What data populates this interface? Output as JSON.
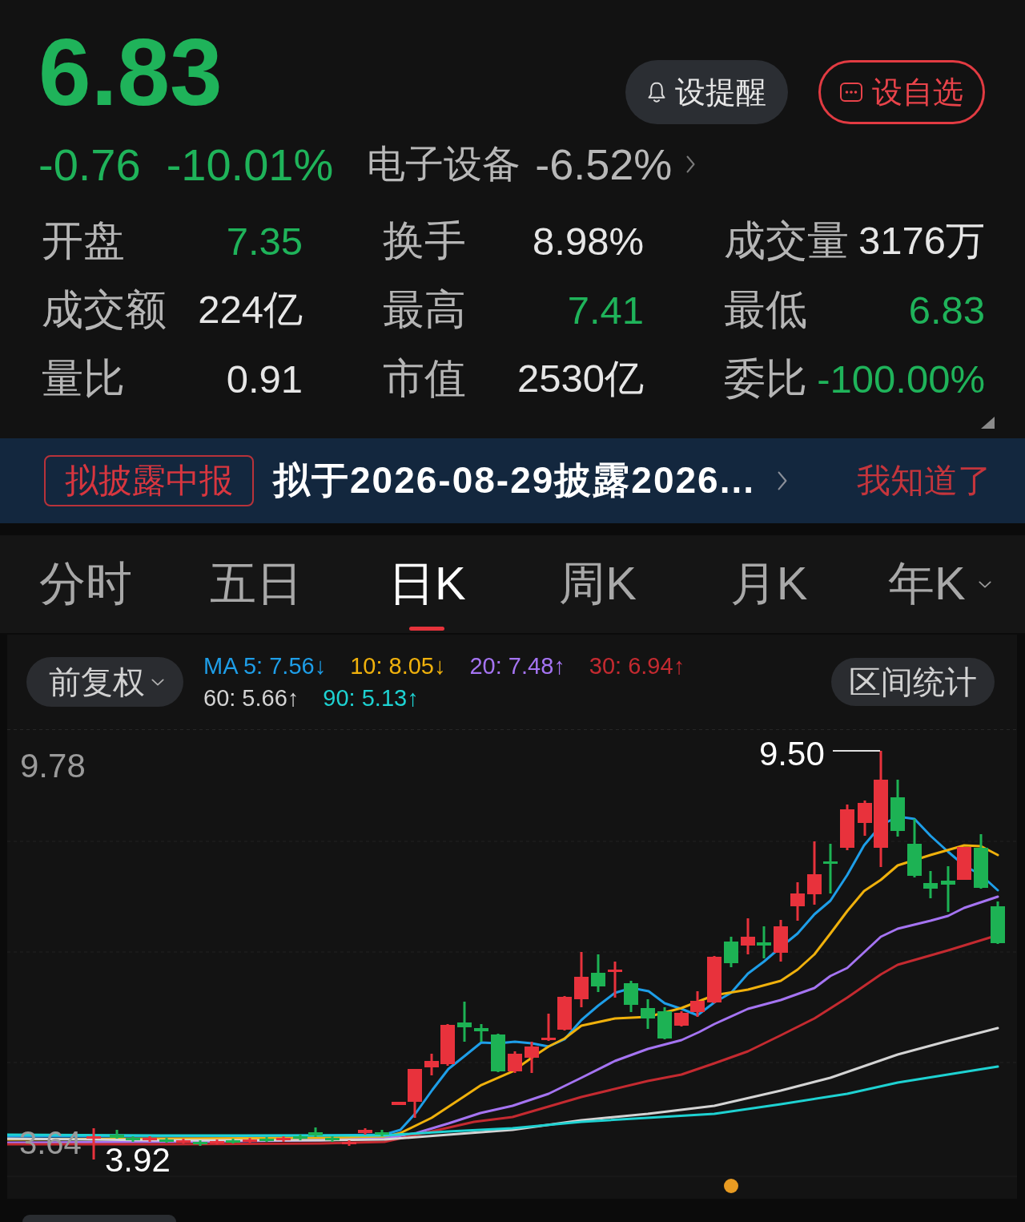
{
  "quote": {
    "price": "6.83",
    "change": "-0.76",
    "change_percent": "-10.01%",
    "color": "#1fb35a",
    "sector": "电子设备",
    "sector_change": "-6.52%"
  },
  "actions": [
    {
      "kind": "alert",
      "label": "设提醒"
    },
    {
      "kind": "watchlist",
      "label": "设自选"
    }
  ],
  "stats": [
    {
      "label": "开盘",
      "value": "7.35",
      "color": "#1fb35a"
    },
    {
      "label": "换手",
      "value": "8.98%",
      "color": "#e6e6e6"
    },
    {
      "label": "成交量",
      "value": "3176万",
      "color": "#e6e6e6"
    },
    {
      "label": "成交额",
      "value": "224亿",
      "color": "#e6e6e6"
    },
    {
      "label": "最高",
      "value": "7.41",
      "color": "#1fb35a"
    },
    {
      "label": "最低",
      "value": "6.83",
      "color": "#1fb35a"
    },
    {
      "label": "量比",
      "value": "0.91",
      "color": "#e6e6e6"
    },
    {
      "label": "市值",
      "value": "2530亿",
      "color": "#e6e6e6"
    },
    {
      "label": "委比",
      "value": "-100.00%",
      "color": "#1fb35a"
    }
  ],
  "notice": {
    "tag": "拟披露中报",
    "text": "拟于2026-08-29披露2026...",
    "dismiss": "我知道了"
  },
  "period_tabs": [
    {
      "label": "分时",
      "selected": false,
      "has_menu": false
    },
    {
      "label": "五日",
      "selected": false,
      "has_menu": false
    },
    {
      "label": "日K",
      "selected": true,
      "has_menu": false
    },
    {
      "label": "周K",
      "selected": false,
      "has_menu": false
    },
    {
      "label": "月K",
      "selected": false,
      "has_menu": false
    },
    {
      "label": "年K",
      "selected": false,
      "has_menu": true
    }
  ],
  "chart_controls": {
    "adjustment": "前复权",
    "range_stats": "区间统计"
  },
  "moving_averages": [
    {
      "label": "MA 5: 7.56↓",
      "color": "#1e9ee8"
    },
    {
      "label": "10: 8.05↓",
      "color": "#f0b10c"
    },
    {
      "label": "20: 7.48↑",
      "color": "#a574f2"
    },
    {
      "label": "30: 6.94↑",
      "color": "#c42a30"
    },
    {
      "label": "60: 5.66↑",
      "color": "#d4d4d4"
    },
    {
      "label": "90: 5.13↑",
      "color": "#1ed2d2"
    }
  ],
  "chart": {
    "top_price": "9.78",
    "bottom_price": "3.64",
    "high_label": "9.50",
    "low_label": "3.92"
  }
}
